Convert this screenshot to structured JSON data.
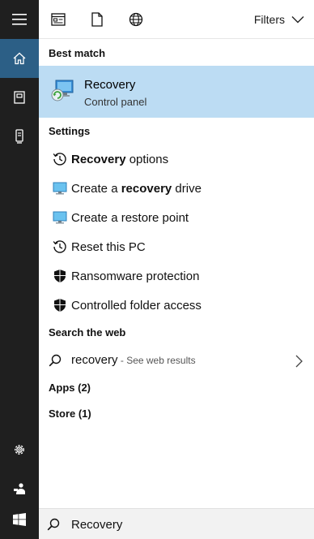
{
  "toolbar": {
    "filters_label": "Filters"
  },
  "sections": {
    "best_match": "Best match",
    "settings": "Settings",
    "search_web": "Search the web"
  },
  "best_match": {
    "title": "Recovery",
    "subtitle": "Control panel"
  },
  "settings_items": [
    {
      "bold": "Recovery",
      "rest": " options",
      "icon": "history-icon"
    },
    {
      "pre": "Create a ",
      "bold": "recovery",
      "rest": " drive",
      "icon": "monitor-icon"
    },
    {
      "text": "Create a restore point",
      "icon": "monitor-icon"
    },
    {
      "text": "Reset this PC",
      "icon": "history-icon"
    },
    {
      "text": "Ransomware protection",
      "icon": "shield-icon"
    },
    {
      "text": "Controlled folder access",
      "icon": "shield-icon"
    }
  ],
  "web": {
    "query": "recovery",
    "hint": " - See web results"
  },
  "categories": {
    "apps": "Apps (2)",
    "store": "Store (1)"
  },
  "search": {
    "value": "Recovery"
  },
  "colors": {
    "rail": "#1f1f1f",
    "rail_active": "#2c5f86",
    "best_match_bg": "#bcdcf3",
    "search_bg": "#f2f2f2"
  }
}
